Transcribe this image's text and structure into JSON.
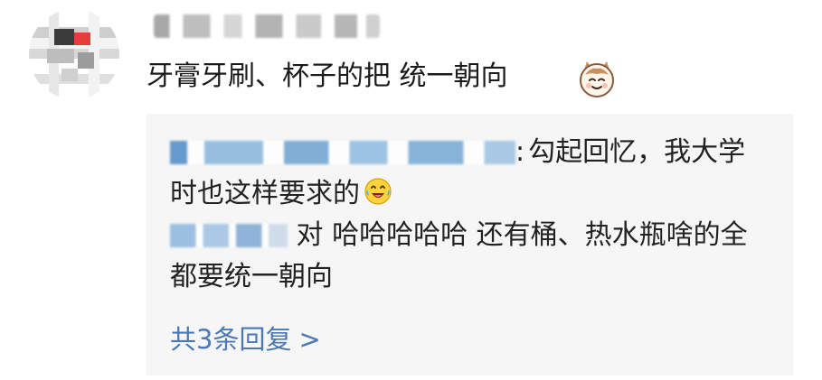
{
  "comment": {
    "text": "牙膏牙刷、杯子的把 统一朝向",
    "emoji_name": "cat-emoji"
  },
  "replies": [
    {
      "text": "勾起回忆，我大学时也这样要求的",
      "emoji_name": "laughing-emoji"
    },
    {
      "text": "对 哈哈哈哈哈 还有桶、热水瓶啥的全都要统一朝向"
    }
  ],
  "separator": ":",
  "view_more": {
    "label": "共3条回复",
    "arrow": ">",
    "color": "#4a78b7"
  },
  "colors": {
    "reply_bg": "#f6f6f6",
    "text": "#1b1b1b"
  }
}
